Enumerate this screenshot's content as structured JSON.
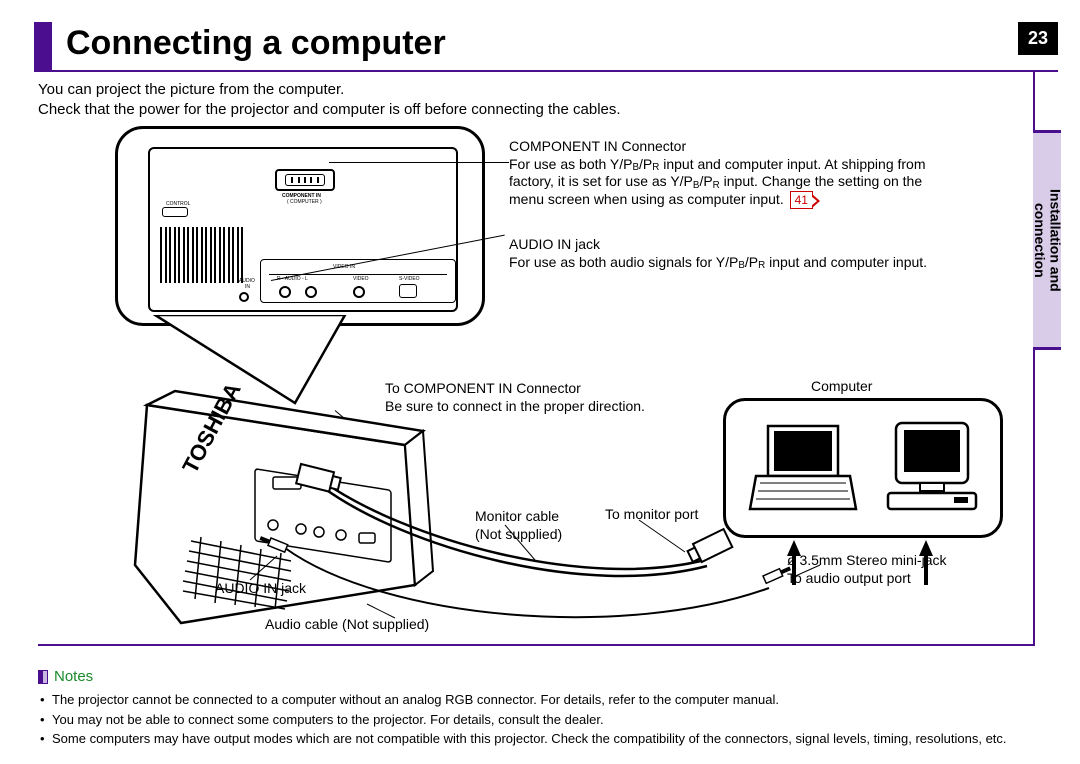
{
  "page_number": "23",
  "title": "Connecting a computer",
  "side_tab": {
    "line1": "Installation and",
    "line2": "connection"
  },
  "intro_line1": "You can project the picture from the computer.",
  "intro_line2": "Check that the power for the projector and computer is off before connecting the cables.",
  "component_in": {
    "title": "COMPONENT IN Connector",
    "desc_a": "For use as both Y/P",
    "desc_a_sub1": "B",
    "desc_a_mid": "/P",
    "desc_a_sub2": "R",
    "desc_a_end": " input and computer input. At shipping from",
    "desc_b": "factory, it is set for use as Y/P",
    "desc_b_sub1": "B",
    "desc_b_mid": "/P",
    "desc_b_sub2": "R",
    "desc_b_end": " input.  Change the setting on the",
    "desc_c": "menu screen when using as computer input.",
    "ref": "41"
  },
  "audio_in": {
    "title": "AUDIO IN jack",
    "desc_a": "For use as both audio signals for Y/P",
    "sub1": "B",
    "mid": "/P",
    "sub2": "R",
    "end": " input and computer input."
  },
  "to_component": {
    "title": "To COMPONENT IN Connector",
    "desc": "Be sure to connect in the proper direction."
  },
  "monitor_cable": {
    "l1": "Monitor cable",
    "l2": "(Not supplied)"
  },
  "to_monitor_port": "To monitor port",
  "computer_label": "Computer",
  "stereo_jack": {
    "l1": "ø 3.5mm Stereo mini-jack",
    "l2": "To audio output port"
  },
  "audio_in_jack_label": "AUDIO IN jack",
  "audio_cable_label": "Audio cable (Not supplied)",
  "brand": "TOSHIBA",
  "panel": {
    "control": "CONTROL",
    "component_in": "COMPONENT IN",
    "computer": "( COMPUTER )",
    "audio_in": "AUDIO",
    "in": "IN",
    "video_in": "VIDEO IN",
    "r_audio_l": "R - AUDIO - L",
    "video": "VIDEO",
    "svideo": "S-VIDEO"
  },
  "notes": {
    "heading": "Notes",
    "items": [
      "The projector cannot be connected to a computer without an analog RGB connector. For details, refer to the computer manual.",
      "You may not be able to connect some computers to the projector. For details, consult the dealer.",
      "Some computers may have output modes which are not compatible with this projector. Check the compatibility of the connectors, signal levels, timing, resolutions, etc."
    ]
  }
}
